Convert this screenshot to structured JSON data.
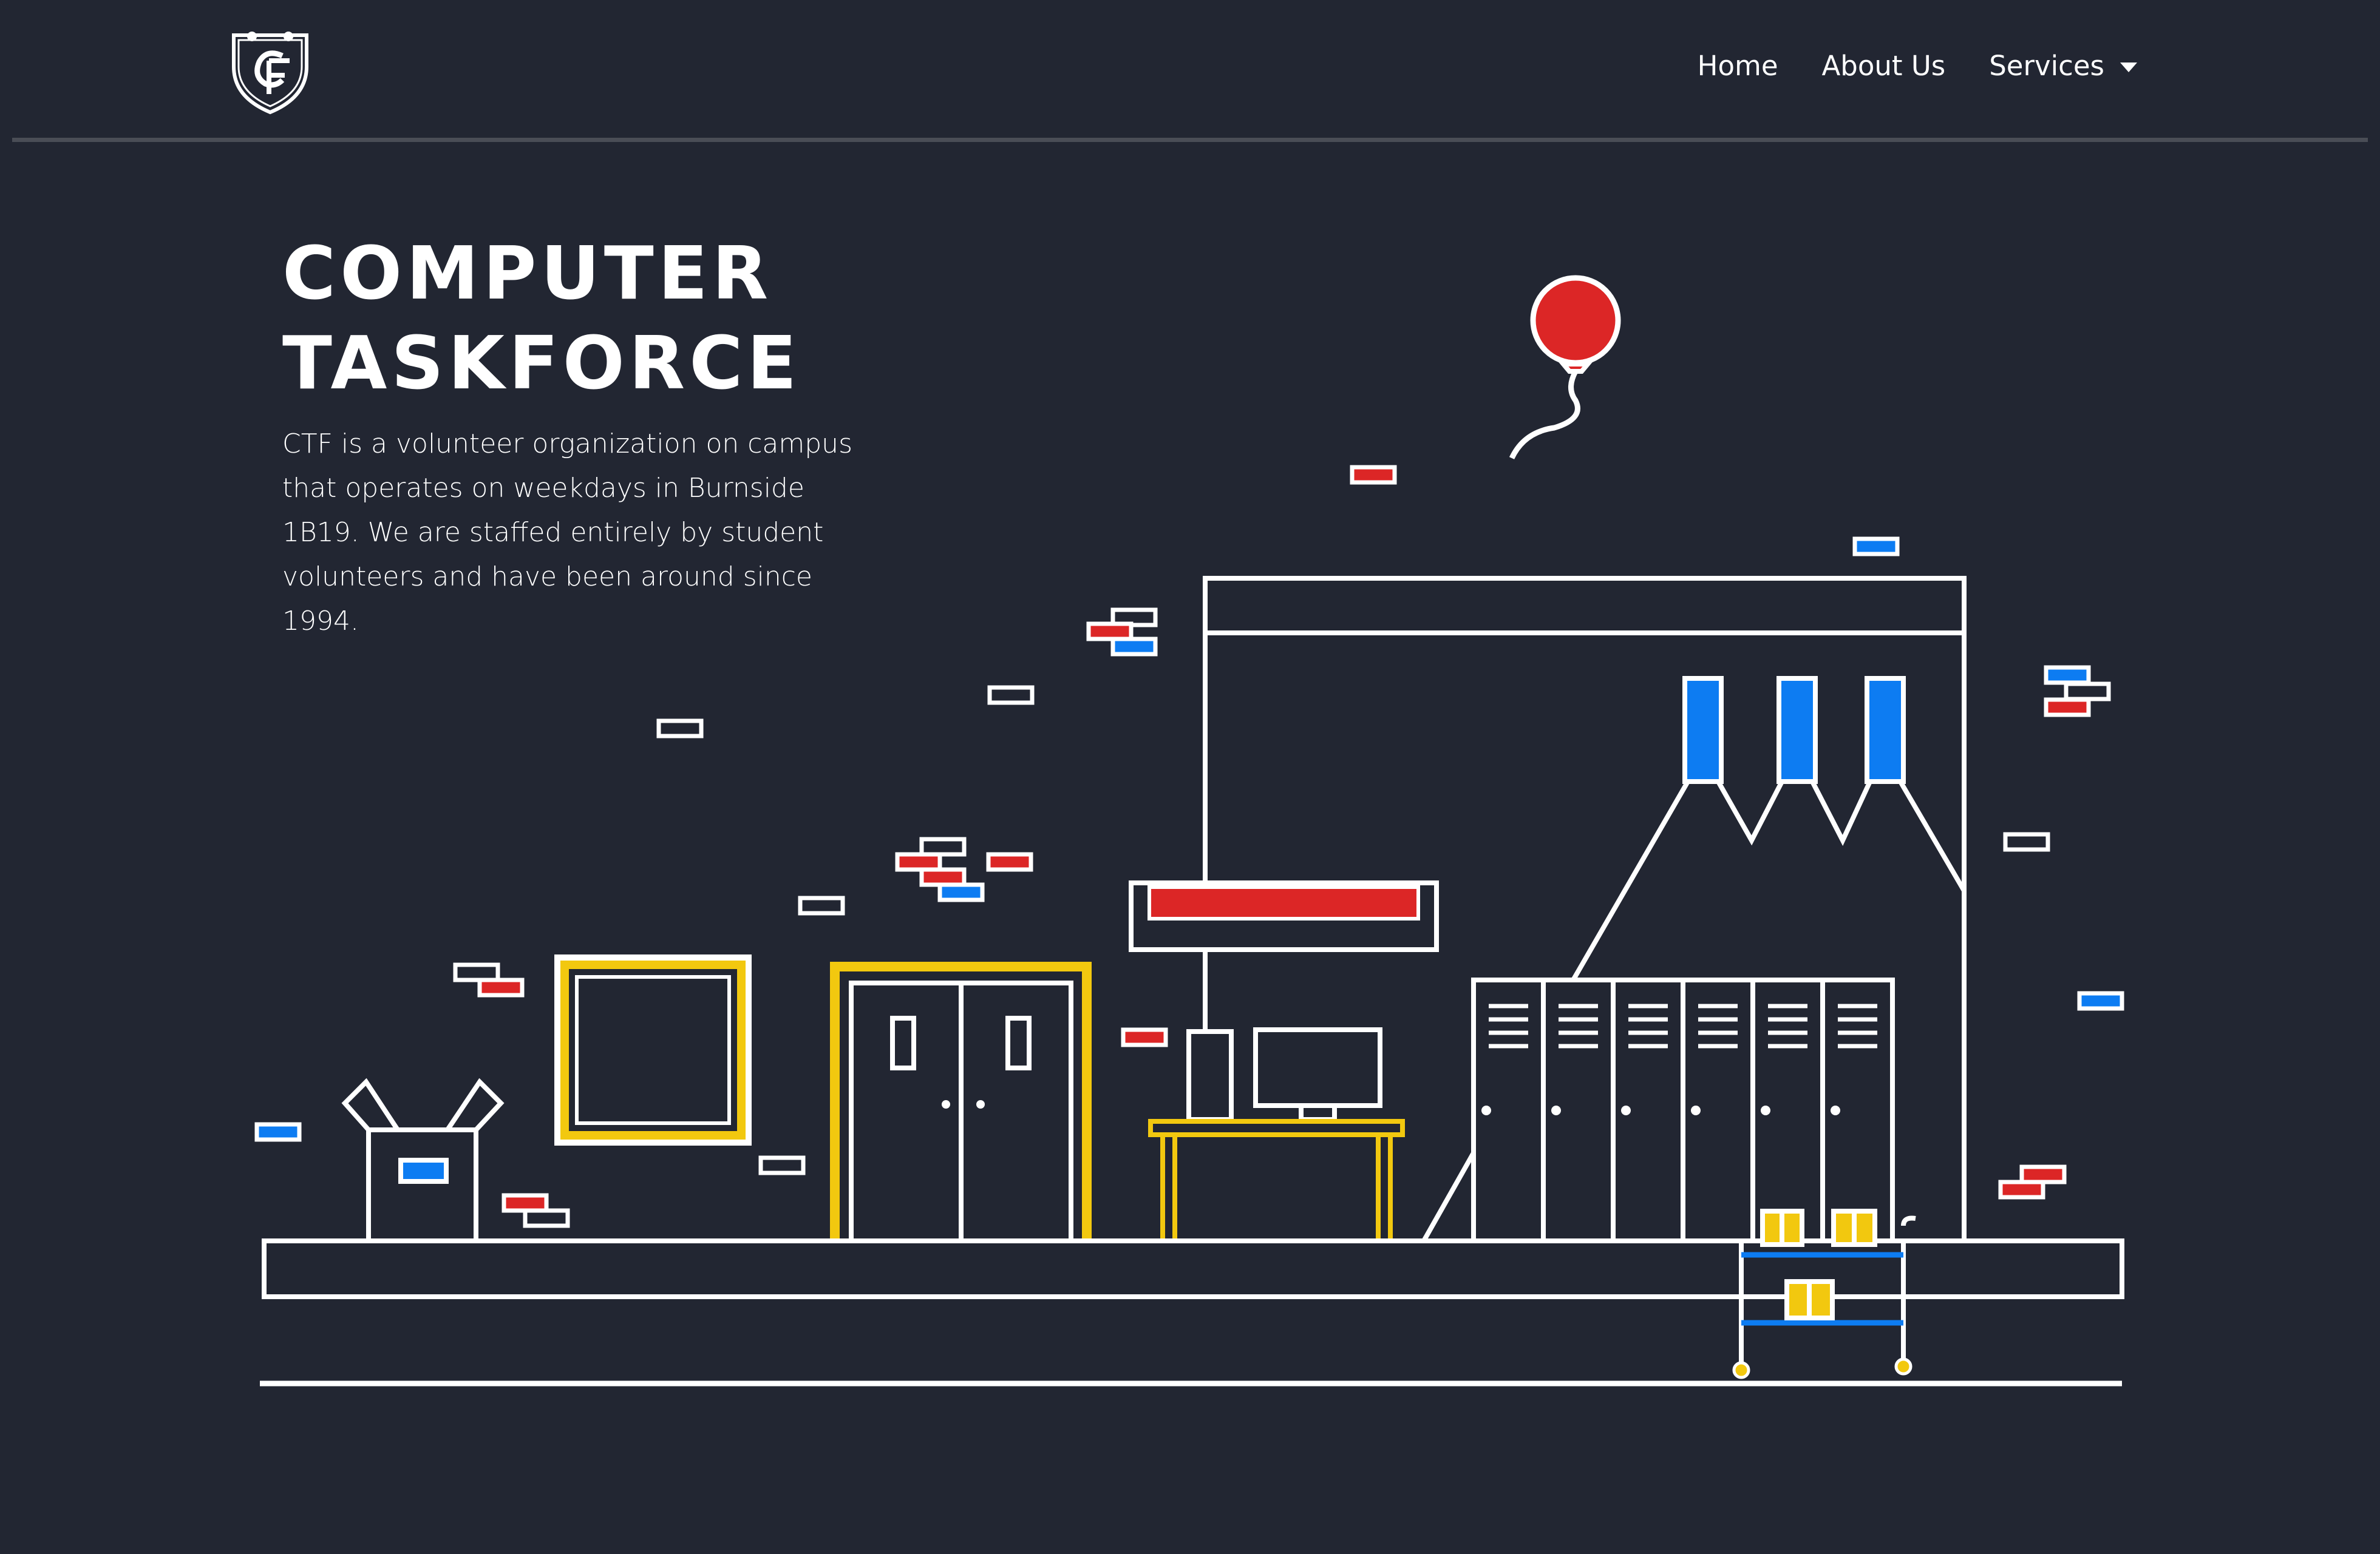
{
  "nav": {
    "logo_alt": "CTF",
    "links": [
      {
        "label": "Home"
      },
      {
        "label": "About Us"
      },
      {
        "label": "Services"
      }
    ]
  },
  "hero": {
    "title_line1": "COMPUTER",
    "title_line2": "TASKFORCE",
    "description": "CTF is a volunteer organization on campus that operates on weekdays in Burnside 1B19. We are staffed entirely by student volunteers and have been around since 1994."
  },
  "colors": {
    "background": "#222632",
    "stroke": "#ffffff",
    "red": "#dc2626",
    "blue": "#0d7cf2",
    "yellow": "#f2c80f"
  },
  "icons": {
    "logo": "ctf-shield-crest-icon",
    "dropdown": "caret-down-icon"
  }
}
